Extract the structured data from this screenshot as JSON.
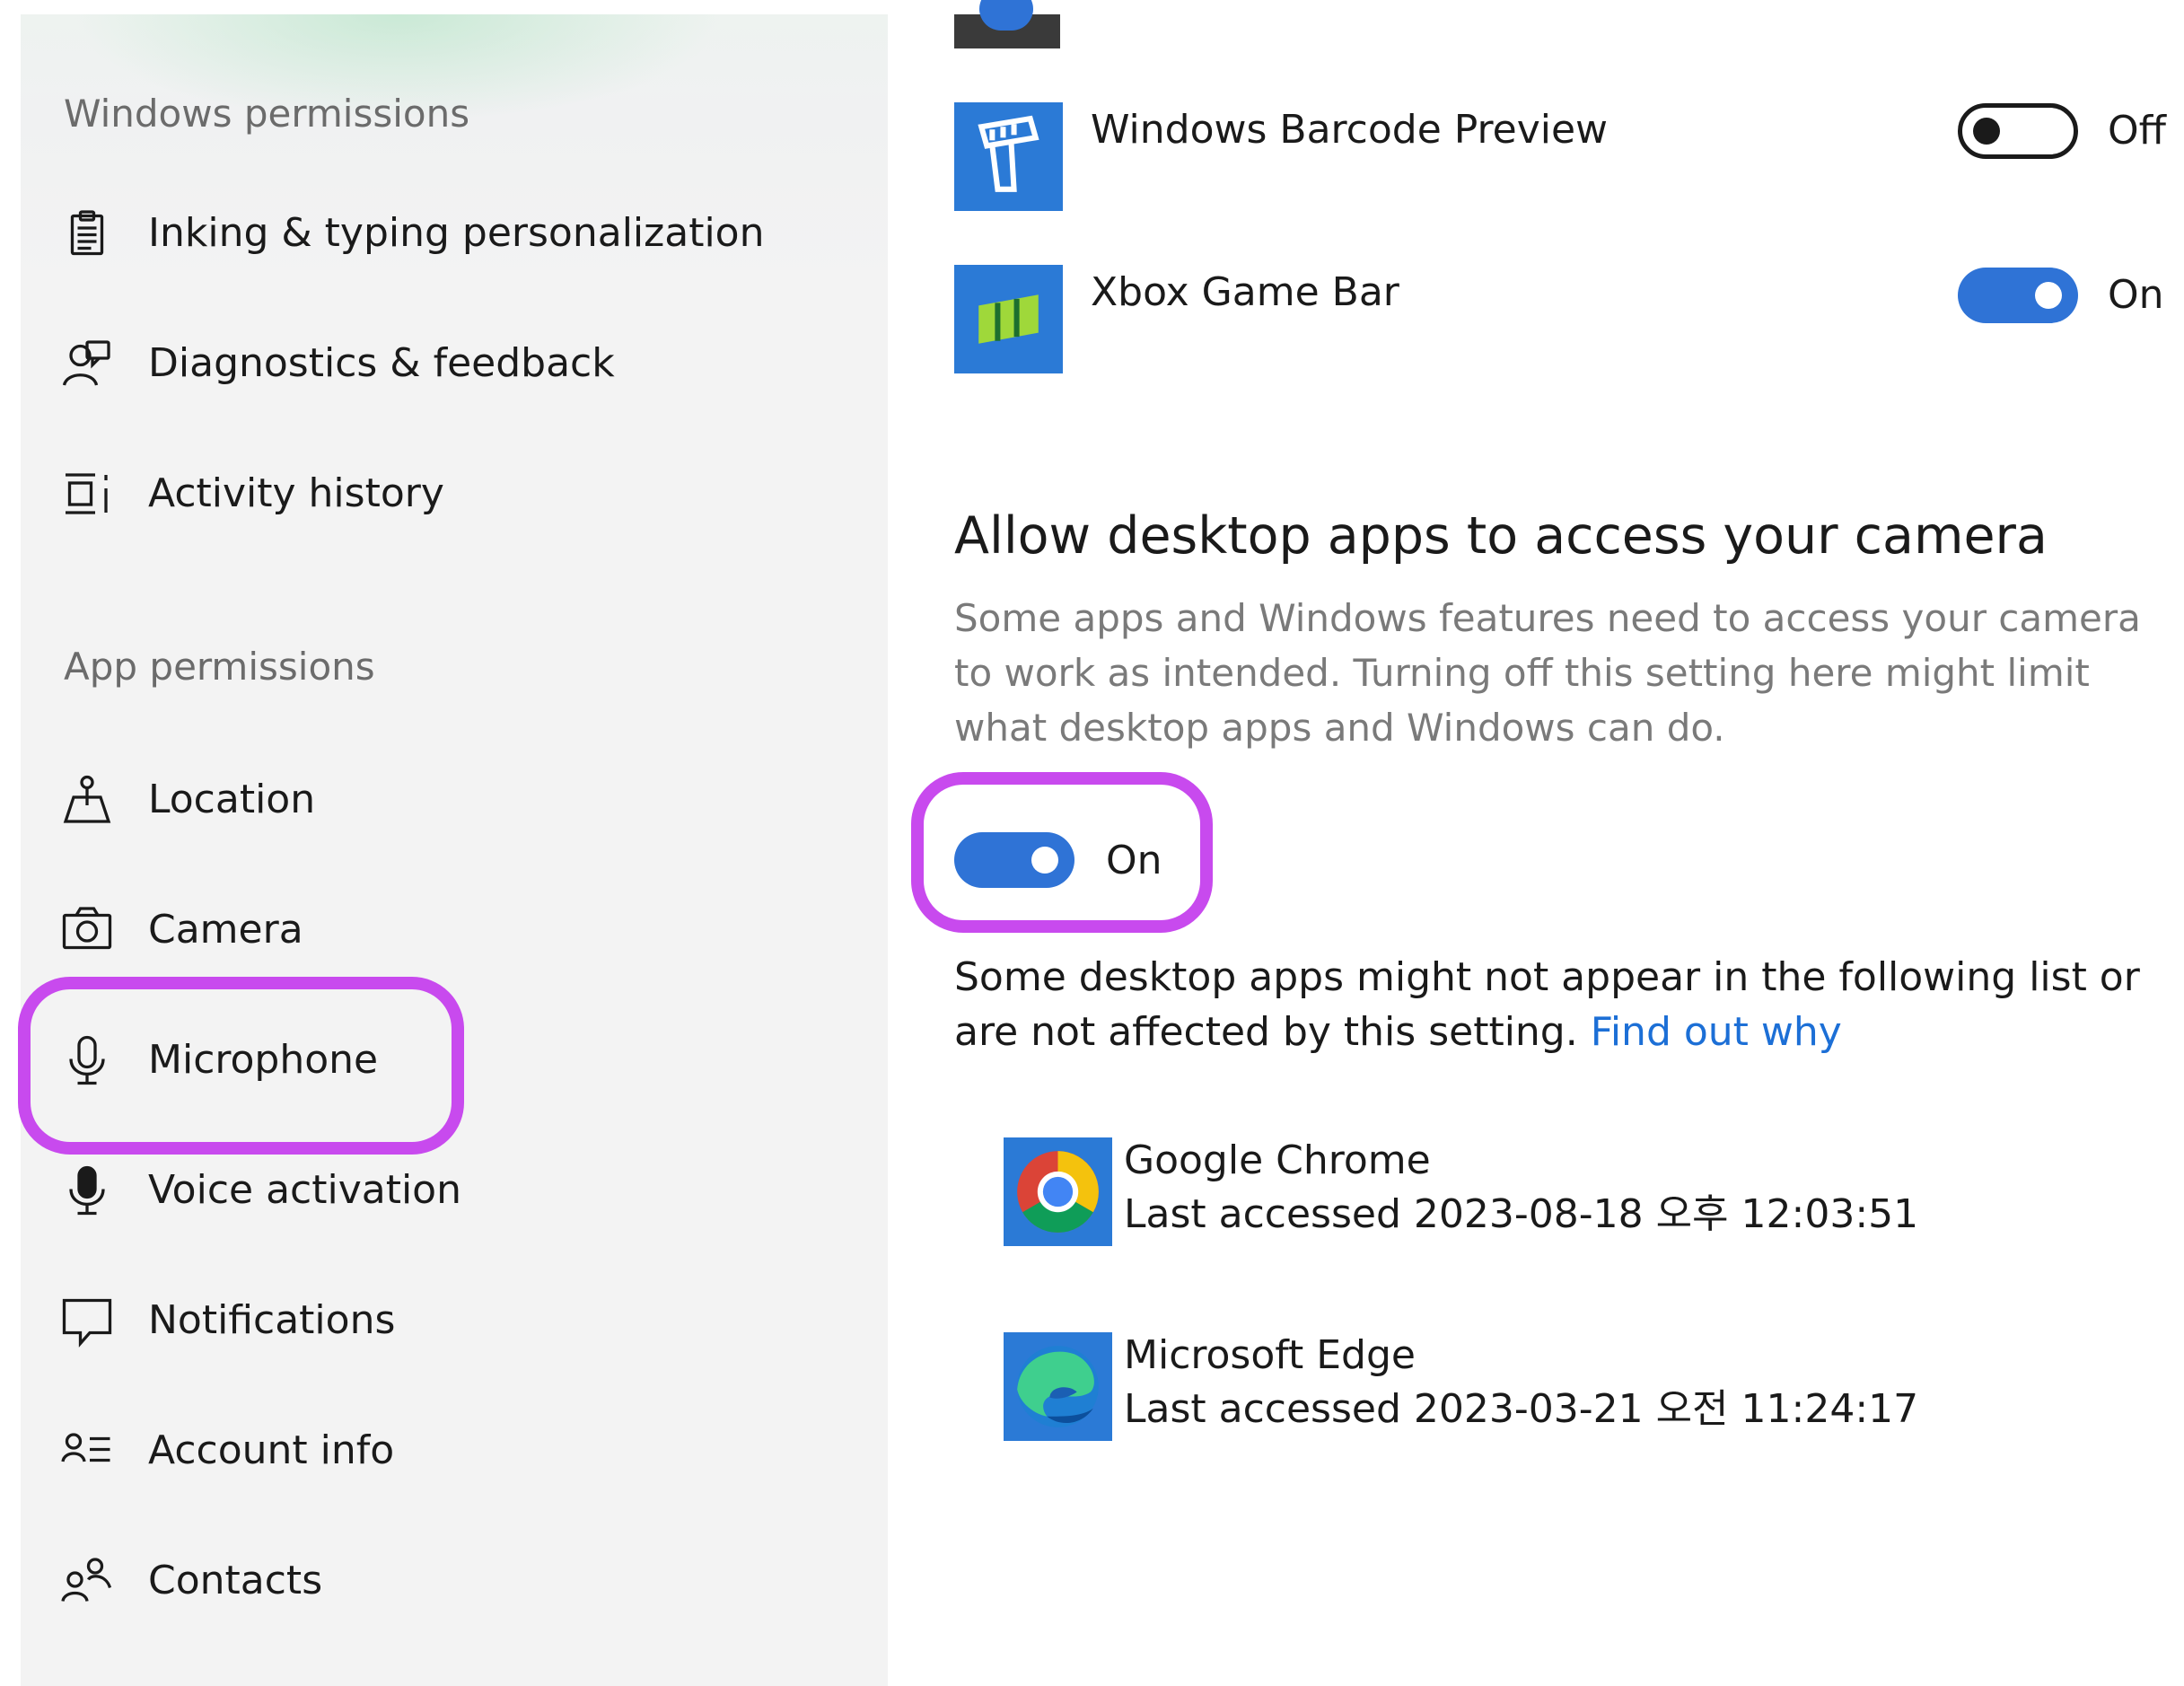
{
  "sidebar": {
    "windows_permissions_label": "Windows permissions",
    "windows_items": [
      {
        "label": "Inking & typing personalization",
        "icon": "clipboard-icon"
      },
      {
        "label": "Diagnostics & feedback",
        "icon": "feedback-person-icon"
      },
      {
        "label": "Activity history",
        "icon": "activity-history-icon"
      }
    ],
    "app_permissions_label": "App permissions",
    "app_items": [
      {
        "label": "Location",
        "icon": "location-icon"
      },
      {
        "label": "Camera",
        "icon": "camera-icon"
      },
      {
        "label": "Microphone",
        "icon": "microphone-icon",
        "highlighted": true
      },
      {
        "label": "Voice activation",
        "icon": "voice-activation-icon"
      },
      {
        "label": "Notifications",
        "icon": "notifications-icon"
      },
      {
        "label": "Account info",
        "icon": "account-info-icon"
      },
      {
        "label": "Contacts",
        "icon": "contacts-icon"
      }
    ]
  },
  "store_apps": [
    {
      "name": "Windows Barcode Preview",
      "icon": "barcode-scanner-icon",
      "state": "Off",
      "enabled": false
    },
    {
      "name": "Xbox Game Bar",
      "icon": "xbox-game-bar-icon",
      "state": "On",
      "enabled": true
    }
  ],
  "desktop_section": {
    "title": "Allow desktop apps to access your camera",
    "description": "Some apps and Windows features need to access your camera to work as intended. Turning off this setting here might limit what desktop apps and Windows can do.",
    "toggle_state": "On",
    "toggle_enabled": true,
    "note": "Some desktop apps might not appear in the following list or are not affected by this setting.",
    "link_text": "Find out why"
  },
  "desktop_apps": [
    {
      "name": "Google Chrome",
      "last_accessed": "Last accessed 2023-08-18 오후 12:03:51",
      "icon": "chrome-icon"
    },
    {
      "name": "Microsoft Edge",
      "last_accessed": "Last accessed 2023-03-21 오전 11:24:17",
      "icon": "edge-icon"
    }
  ],
  "colors": {
    "accent": "#2f73d6",
    "link": "#1c6fd6",
    "highlight_outline": "#c84aee",
    "sidebar_bg": "#f3f3f3",
    "app_tile": "#2b7ad6"
  }
}
